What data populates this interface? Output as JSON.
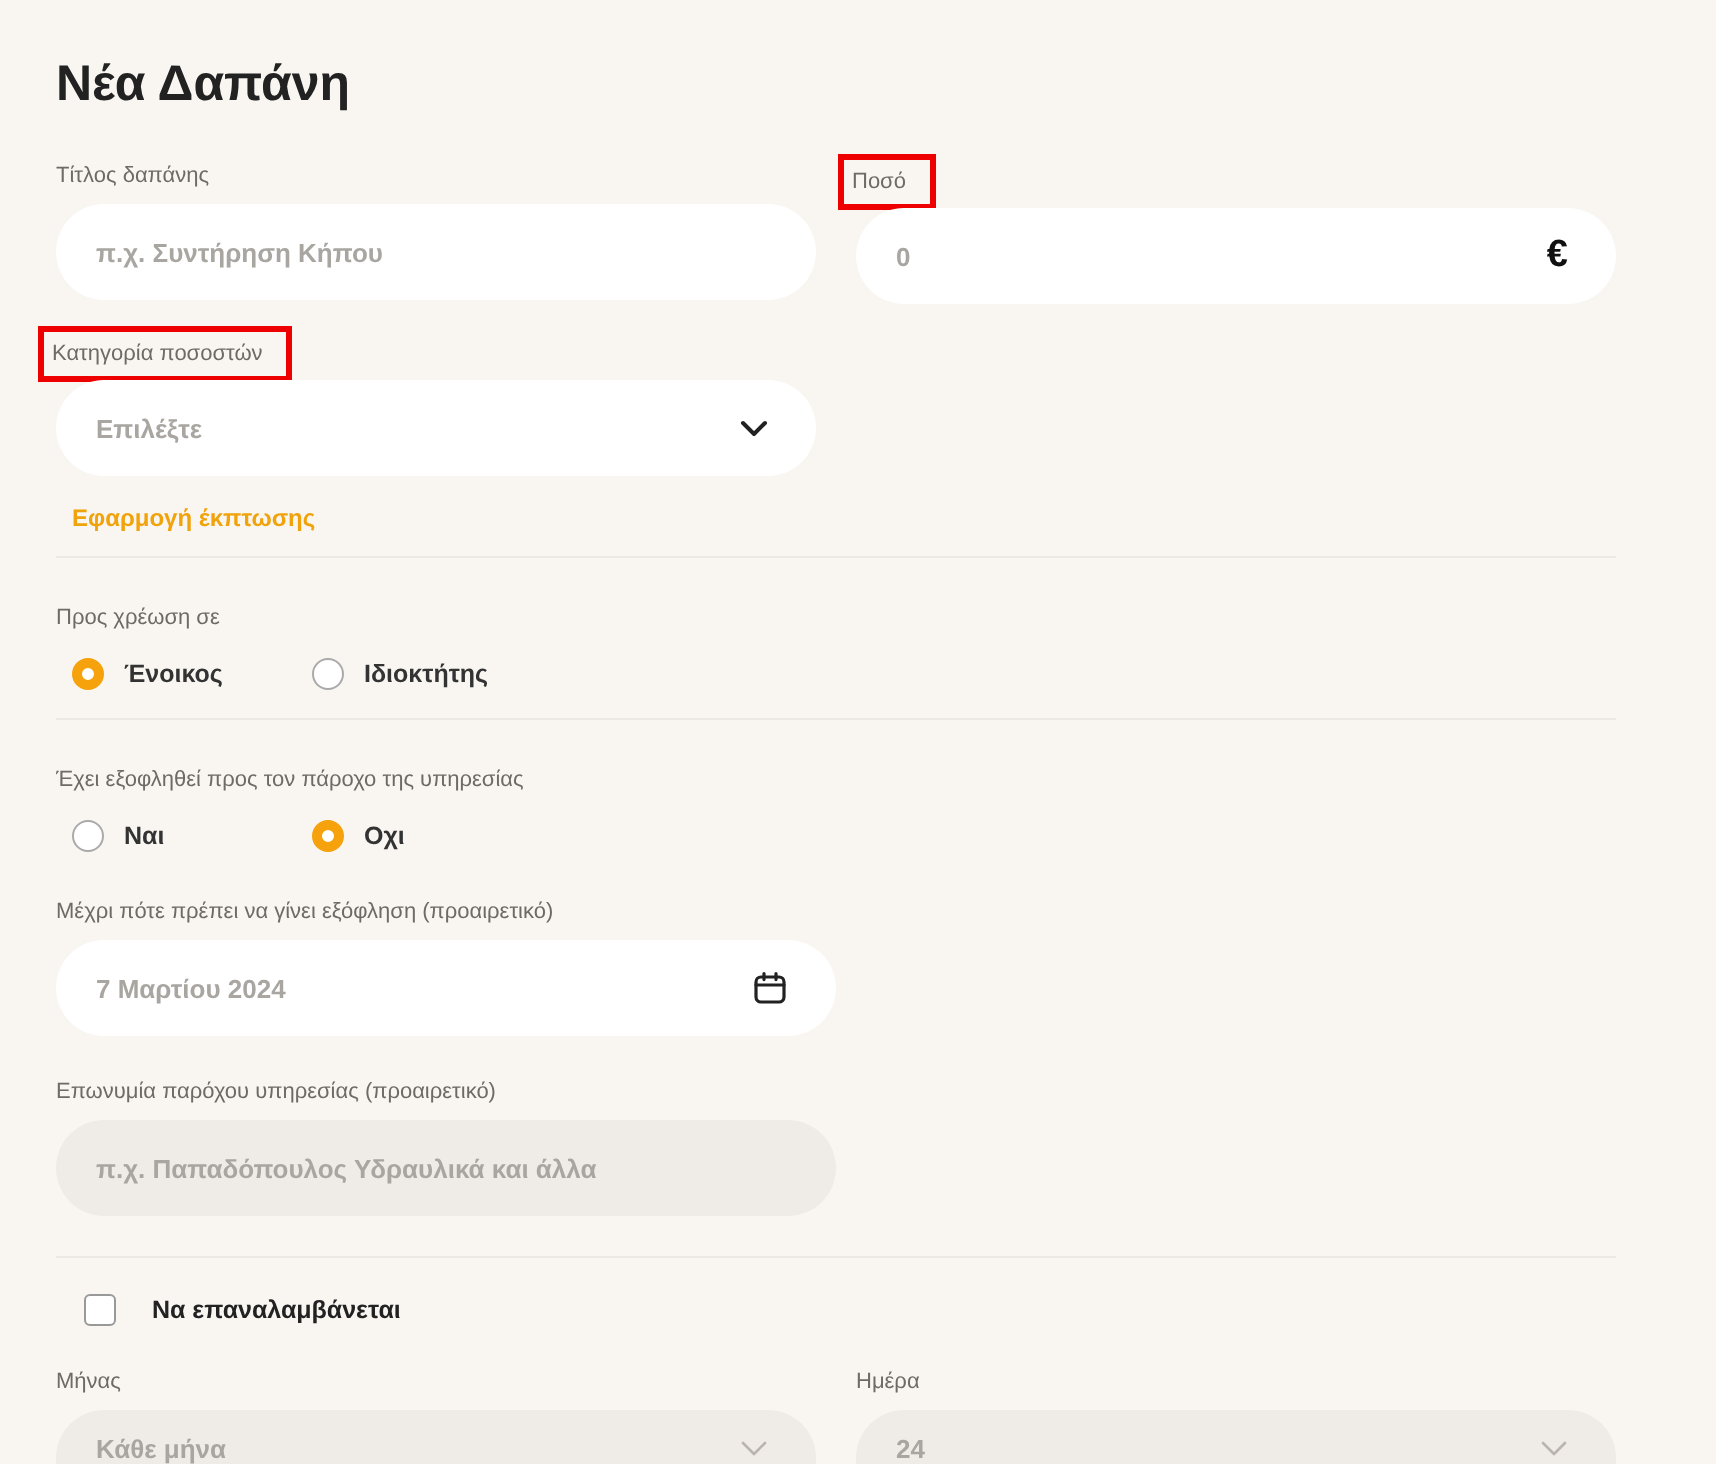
{
  "title": "Νέα Δαπάνη",
  "expense_title": {
    "label": "Τίτλος δαπάνης",
    "highlighted": false,
    "placeholder": "π.χ. Συντήρηση Κήπου"
  },
  "amount": {
    "label": "Ποσό",
    "highlighted": true,
    "placeholder": "0",
    "unit": "€"
  },
  "category": {
    "label": "Κατηγορία ποσοστών",
    "highlighted": true,
    "placeholder": "Επιλέξτε"
  },
  "discount_link": "Εφαρμογή έκπτωσης",
  "charge_to": {
    "label": "Προς χρέωση σε",
    "options": [
      {
        "label": "Ένοικος",
        "selected": true
      },
      {
        "label": "Ιδιοκτήτης",
        "selected": false
      }
    ]
  },
  "paid": {
    "label": "Έχει εξοφληθεί προς τον πάροχο της υπηρεσίας",
    "options": [
      {
        "label": "Ναι",
        "selected": false
      },
      {
        "label": "Οχι",
        "selected": true
      }
    ]
  },
  "due_date": {
    "label": "Μέχρι πότε πρέπει να γίνει εξόφληση (προαιρετικό)",
    "value": "7 Μαρτίου 2024"
  },
  "provider": {
    "label": "Επωνυμία παρόχου υπηρεσίας (προαιρετικό)",
    "placeholder": "π.χ. Παπαδόπουλος Υδραυλικά και άλλα",
    "disabled": true
  },
  "recurring": {
    "label": "Να επαναλαμβάνεται",
    "checked": false
  },
  "month": {
    "label": "Μήνας",
    "value": "Κάθε μήνα",
    "disabled": true
  },
  "day": {
    "label": "Ημέρα",
    "value": "24",
    "disabled": true
  }
}
